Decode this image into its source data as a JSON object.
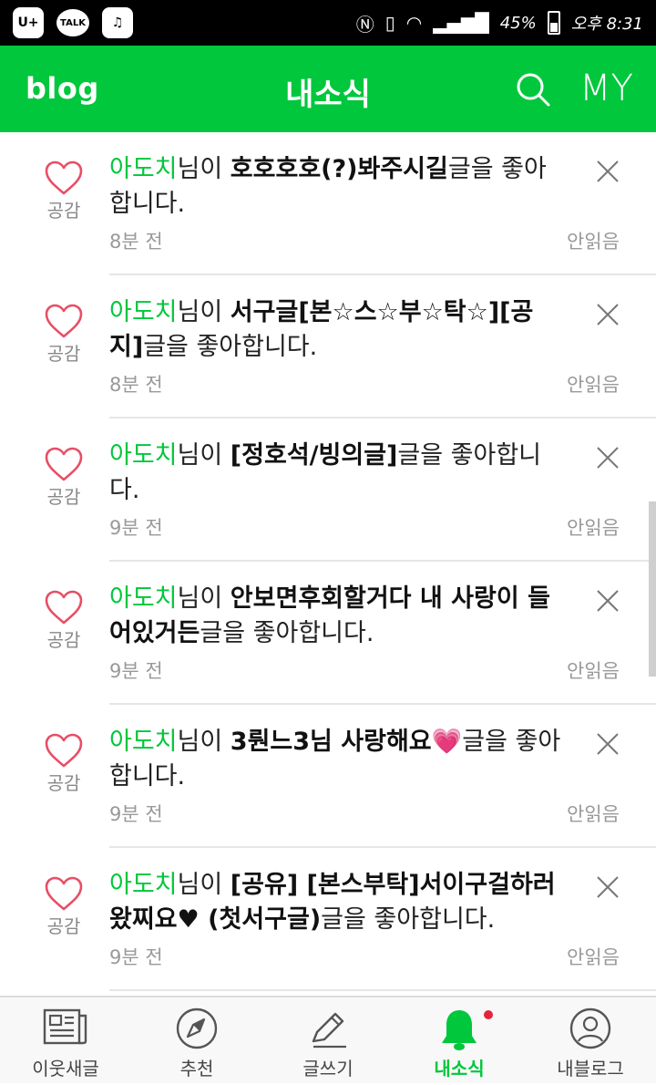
{
  "status_bar": {
    "battery": "45%",
    "time": "오후 8:31",
    "apps": [
      "U+",
      "TALK",
      "music"
    ]
  },
  "header": {
    "logo": "blog",
    "title": "내소식",
    "my_label": "MY"
  },
  "notifications": [
    {
      "user": "아도치",
      "suffix1": "님이 ",
      "post": "호호호호(?)봐주시길",
      "suffix2": "글을 좋아합니다.",
      "time": "8분 전",
      "status": "안읽음",
      "like_label": "공감"
    },
    {
      "user": "아도치",
      "suffix1": "님이 ",
      "post": "서구글[본☆스☆부☆탁☆][공지]",
      "suffix2": "글을 좋아합니다.",
      "time": "8분 전",
      "status": "안읽음",
      "like_label": "공감"
    },
    {
      "user": "아도치",
      "suffix1": "님이 ",
      "post": "[정호석/빙의글]",
      "suffix2": "글을 좋아합니다.",
      "time": "9분 전",
      "status": "안읽음",
      "like_label": "공감"
    },
    {
      "user": "아도치",
      "suffix1": "님이 ",
      "post": "안보면후회할거다 내 사랑이 들어있거든",
      "suffix2": "글을 좋아합니다.",
      "time": "9분 전",
      "status": "안읽음",
      "like_label": "공감"
    },
    {
      "user": "아도치",
      "suffix1": "님이 ",
      "post": "3뤈느3님 사랑해요💗",
      "suffix2": "글을 좋아합니다.",
      "time": "9분 전",
      "status": "안읽음",
      "like_label": "공감"
    },
    {
      "user": "아도치",
      "suffix1": "님이 ",
      "post": "[공유] [본스부탁]서이구걸하러왔찌요♥ (첫서구글)",
      "suffix2": "글을 좋아합니다.",
      "time": "9분 전",
      "status": "안읽음",
      "like_label": "공감"
    }
  ],
  "tabs": [
    {
      "label": "이웃새글",
      "icon": "newspaper-icon"
    },
    {
      "label": "추천",
      "icon": "compass-icon"
    },
    {
      "label": "글쓰기",
      "icon": "pencil-icon"
    },
    {
      "label": "내소식",
      "icon": "bell-icon",
      "active": true
    },
    {
      "label": "내블로그",
      "icon": "person-icon"
    }
  ],
  "colors": {
    "brand": "#00c73c",
    "badge": "#e5243b"
  }
}
